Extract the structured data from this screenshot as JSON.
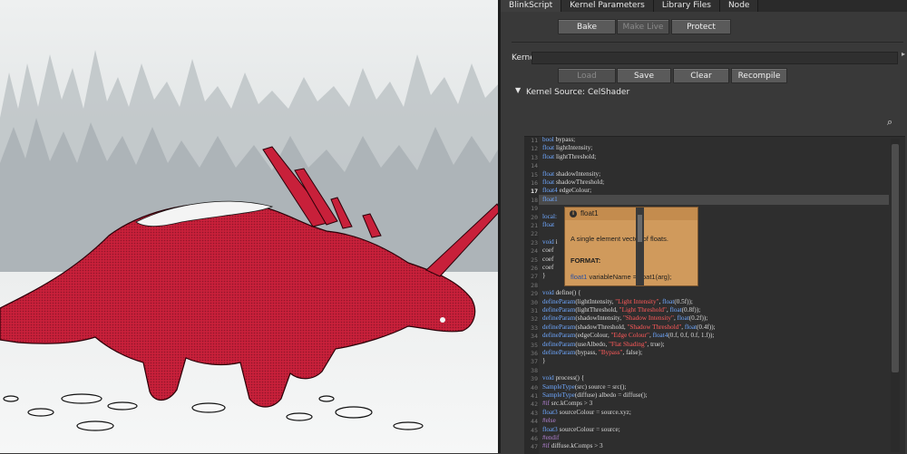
{
  "tabs": [
    {
      "label": "BlinkScript",
      "active": true
    },
    {
      "label": "Kernel Parameters",
      "active": false
    },
    {
      "label": "Library Files",
      "active": false
    },
    {
      "label": "Node",
      "active": false
    }
  ],
  "actions": {
    "bake": "Bake",
    "make_live": "Make Live",
    "protect": "Protect"
  },
  "kernel_file": {
    "label": "Kernel File",
    "value": ""
  },
  "file_buttons": {
    "load": "Load",
    "save": "Save",
    "clear": "Clear",
    "recompile": "Recompile"
  },
  "kernel_source": {
    "label": "Kernel Source: CelShader"
  },
  "editor": {
    "current_line": "17",
    "lines": [
      {
        "n": "11",
        "segs": [
          {
            "t": "bool",
            "c": "kw"
          },
          {
            "t": " bypass;",
            "c": ""
          }
        ]
      },
      {
        "n": "12",
        "segs": [
          {
            "t": "float",
            "c": "kw"
          },
          {
            "t": " lightIntensity;",
            "c": ""
          }
        ]
      },
      {
        "n": "13",
        "segs": [
          {
            "t": "float",
            "c": "kw"
          },
          {
            "t": " lightThreshold;",
            "c": ""
          }
        ]
      },
      {
        "n": "14",
        "segs": []
      },
      {
        "n": "15",
        "segs": [
          {
            "t": "float",
            "c": "kw"
          },
          {
            "t": " shadowIntensity;",
            "c": ""
          }
        ]
      },
      {
        "n": "16",
        "segs": [
          {
            "t": "float",
            "c": "kw"
          },
          {
            "t": " shadowThreshold;",
            "c": ""
          }
        ]
      },
      {
        "n": "17",
        "segs": [
          {
            "t": "float4",
            "c": "kw"
          },
          {
            "t": " edgeColour;",
            "c": ""
          }
        ]
      },
      {
        "n": "18",
        "segs": [
          {
            "t": "float1",
            "c": "kw"
          }
        ]
      },
      {
        "n": "19",
        "segs": []
      },
      {
        "n": "20",
        "segs": [
          {
            "t": "local:",
            "c": "kw"
          }
        ]
      },
      {
        "n": "21",
        "segs": [
          {
            "t": "  float",
            "c": "kw"
          }
        ]
      },
      {
        "n": "22",
        "segs": []
      },
      {
        "n": "23",
        "segs": [
          {
            "t": "void",
            "c": "kw"
          },
          {
            "t": " i",
            "c": ""
          }
        ]
      },
      {
        "n": "24",
        "segs": [
          {
            "t": "  coef",
            "c": ""
          }
        ]
      },
      {
        "n": "25",
        "segs": [
          {
            "t": "  coef",
            "c": ""
          }
        ]
      },
      {
        "n": "26",
        "segs": [
          {
            "t": "  coef",
            "c": ""
          }
        ]
      },
      {
        "n": "27",
        "segs": [
          {
            "t": "}",
            "c": ""
          }
        ]
      },
      {
        "n": "28",
        "segs": []
      },
      {
        "n": "29",
        "segs": [
          {
            "t": "void",
            "c": "kw"
          },
          {
            "t": " define() {",
            "c": ""
          }
        ]
      },
      {
        "n": "30",
        "segs": [
          {
            "t": "  defineParam",
            "c": "kw"
          },
          {
            "t": "(lightIntensity, ",
            "c": ""
          },
          {
            "t": "\"Light Intensity\"",
            "c": "str"
          },
          {
            "t": ", ",
            "c": ""
          },
          {
            "t": "float",
            "c": "kw"
          },
          {
            "t": "(0.5f));",
            "c": ""
          }
        ]
      },
      {
        "n": "31",
        "segs": [
          {
            "t": "  defineParam",
            "c": "kw"
          },
          {
            "t": "(lightThreshold, ",
            "c": ""
          },
          {
            "t": "\"Light Threshold\"",
            "c": "str"
          },
          {
            "t": ", ",
            "c": ""
          },
          {
            "t": "float",
            "c": "kw"
          },
          {
            "t": "(0.8f));",
            "c": ""
          }
        ]
      },
      {
        "n": "32",
        "segs": [
          {
            "t": "  defineParam",
            "c": "kw"
          },
          {
            "t": "(shadowIntensity, ",
            "c": ""
          },
          {
            "t": "\"Shadow Intensity\"",
            "c": "str"
          },
          {
            "t": ", ",
            "c": ""
          },
          {
            "t": "float",
            "c": "kw"
          },
          {
            "t": "(0.2f));",
            "c": ""
          }
        ]
      },
      {
        "n": "33",
        "segs": [
          {
            "t": "  defineParam",
            "c": "kw"
          },
          {
            "t": "(shadowThreshold, ",
            "c": ""
          },
          {
            "t": "\"Shadow Threshold\"",
            "c": "str"
          },
          {
            "t": ", ",
            "c": ""
          },
          {
            "t": "float",
            "c": "kw"
          },
          {
            "t": "(0.4f));",
            "c": ""
          }
        ]
      },
      {
        "n": "34",
        "segs": [
          {
            "t": "  defineParam",
            "c": "kw"
          },
          {
            "t": "(edgeColour, ",
            "c": ""
          },
          {
            "t": "\"Edge Colour\"",
            "c": "str"
          },
          {
            "t": ", ",
            "c": ""
          },
          {
            "t": "float4",
            "c": "kw"
          },
          {
            "t": "(0.f, 0.f, 0.f, 1.f));",
            "c": ""
          }
        ]
      },
      {
        "n": "35",
        "segs": [
          {
            "t": "  defineParam",
            "c": "kw"
          },
          {
            "t": "(useAlbedo, ",
            "c": ""
          },
          {
            "t": "\"Flat Shading\"",
            "c": "str"
          },
          {
            "t": ", true);",
            "c": ""
          }
        ]
      },
      {
        "n": "36",
        "segs": [
          {
            "t": "  defineParam",
            "c": "kw"
          },
          {
            "t": "(bypass, ",
            "c": ""
          },
          {
            "t": "\"Bypass\"",
            "c": "str"
          },
          {
            "t": ", false);",
            "c": ""
          }
        ]
      },
      {
        "n": "37",
        "segs": [
          {
            "t": "}",
            "c": ""
          }
        ]
      },
      {
        "n": "38",
        "segs": []
      },
      {
        "n": "39",
        "segs": [
          {
            "t": "void",
            "c": "kw"
          },
          {
            "t": " process() {",
            "c": ""
          }
        ]
      },
      {
        "n": "40",
        "segs": [
          {
            "t": "  SampleType",
            "c": "kw"
          },
          {
            "t": "(src) source = src();",
            "c": ""
          }
        ]
      },
      {
        "n": "41",
        "segs": [
          {
            "t": "  SampleType",
            "c": "kw"
          },
          {
            "t": "(diffuse) albedo = diffuse();",
            "c": ""
          }
        ]
      },
      {
        "n": "42",
        "segs": [
          {
            "t": "#if",
            "c": "pp"
          },
          {
            "t": " src.kComps > 3",
            "c": ""
          }
        ]
      },
      {
        "n": "43",
        "segs": [
          {
            "t": "  float3",
            "c": "kw"
          },
          {
            "t": " sourceColour = source.xyz;",
            "c": ""
          }
        ]
      },
      {
        "n": "44",
        "segs": [
          {
            "t": "#else",
            "c": "pp"
          }
        ]
      },
      {
        "n": "45",
        "segs": [
          {
            "t": "  float3",
            "c": "kw"
          },
          {
            "t": " sourceColour = source;",
            "c": ""
          }
        ]
      },
      {
        "n": "46",
        "segs": [
          {
            "t": "#endif",
            "c": "pp"
          }
        ]
      },
      {
        "n": "47",
        "segs": [
          {
            "t": "#if",
            "c": "pp"
          },
          {
            "t": " diffuse.kComps > 3",
            "c": ""
          }
        ]
      }
    ]
  },
  "tooltip": {
    "title": "float1",
    "description": "A single element vector of floats.",
    "format_heading": "FORMAT:",
    "format_keyword": "float1",
    "format_rest": " variableName = float1(arg);"
  },
  "colors": {
    "accent_keyword": "#6fa8ff",
    "string": "#ff5a5a",
    "tooltip_bg": "#d09a5c",
    "dino": "#c8203a"
  }
}
